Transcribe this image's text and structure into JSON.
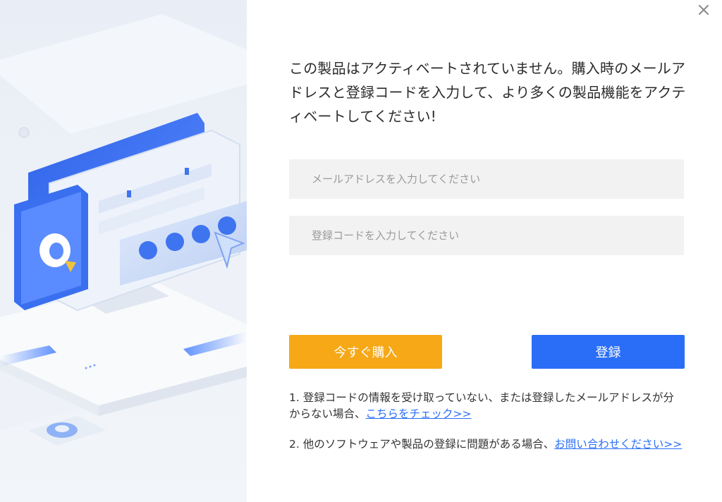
{
  "dialog": {
    "close_symbol": "×",
    "message": "この製品はアクティベートされていません。購入時のメールアドレスと登録コードを入力して、より多くの製品機能をアクティベートしてください!",
    "email": {
      "value": "",
      "placeholder": "メールアドレスを入力してください"
    },
    "code": {
      "value": "",
      "placeholder": "登録コードを入力してください"
    },
    "buy_label": "今すぐ購入",
    "register_label": "登録",
    "note1": {
      "text": "1. 登録コードの情報を受け取っていない、または登録したメールアドレスが分からない場合、",
      "link": "こちらをチェック>>"
    },
    "note2": {
      "text": "2. 他のソフトウェアや製品の登録に問題がある場合、",
      "link": "お問い合わせください>>"
    }
  },
  "colors": {
    "buy": "#f6a817",
    "register": "#2a6ef7",
    "link": "#2a6ef7",
    "field_bg": "#f2f2f2"
  },
  "icons": [
    "close-icon",
    "app-logo-icon",
    "cursor-arrow-icon"
  ]
}
